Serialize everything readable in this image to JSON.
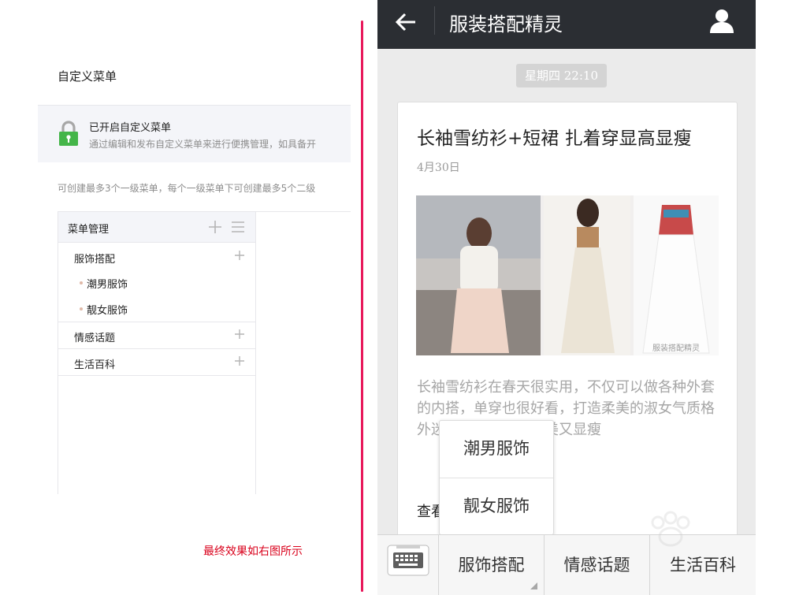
{
  "admin": {
    "page_title": "自定义菜单",
    "notice": {
      "title": "已开启自定义菜单",
      "description": "通过编辑和发布自定义菜单来进行便携管理，如具备开"
    },
    "hint": "可创建最多3个一级菜单，每个一级菜单下可创建最多5个二级",
    "menu_header": "菜单管理",
    "menus": [
      {
        "label": "服饰搭配",
        "children": [
          "潮男服饰",
          "靓女服饰"
        ]
      },
      {
        "label": "情感话题",
        "children": []
      },
      {
        "label": "生活百科",
        "children": []
      }
    ],
    "result_note": "最终效果如右图所示"
  },
  "phone": {
    "title": "服装搭配精灵",
    "timestamp": "星期四 22:10",
    "article": {
      "title": "长袖雪纺衫+短裙 扎着穿显高显瘦",
      "date": "4月30日",
      "photo_watermark": "服装搭配精灵",
      "description": "长袖雪纺衫在春天很实用，不仅可以做各种外套的内搭，单穿也很好看，打造柔美的淑女气质格外迷人，搭配短裙甜美又显瘦",
      "more": "查看全文"
    },
    "popup_items": [
      "潮男服饰",
      "靓女服饰"
    ],
    "tabs": [
      "服饰搭配",
      "情感话题",
      "生活百科"
    ]
  },
  "colors": {
    "accent_red": "#e8185b",
    "note_red": "#d9001b",
    "lock_green": "#44b549",
    "topbar": "#2b2e33"
  },
  "icons": [
    "lock-icon",
    "plus-icon",
    "list-icon",
    "back-arrow-icon",
    "user-icon",
    "keyboard-icon"
  ]
}
